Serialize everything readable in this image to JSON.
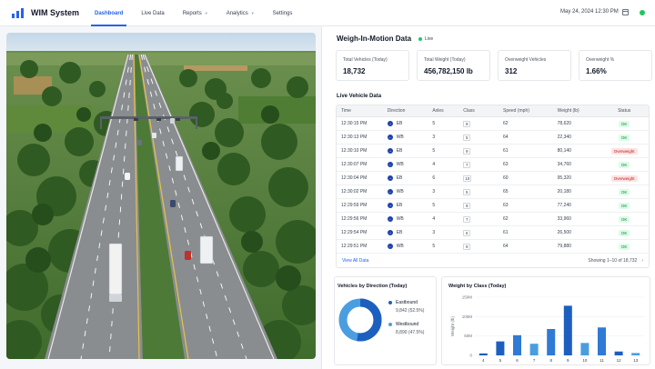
{
  "app": {
    "title": "WIM System"
  },
  "nav": {
    "dashboard": "Dashboard",
    "live_data": "Live Data",
    "reports": "Reports",
    "analytics": "Analytics",
    "settings": "Settings"
  },
  "header": {
    "datetime": "May 24, 2024  12:30 PM"
  },
  "panel": {
    "title": "Weigh-In-Motion Data",
    "live_label": "Live"
  },
  "stats": [
    {
      "label": "Total Vehicles (Today)",
      "value": "18,732"
    },
    {
      "label": "Total Weight (Today)",
      "value": "456,782,150 lb"
    },
    {
      "label": "Overweight Vehicles",
      "value": "312"
    },
    {
      "label": "Overweight %",
      "value": "1.66%"
    }
  ],
  "live_table": {
    "title": "Live Vehicle Data",
    "columns": [
      "Time",
      "Direction",
      "Axles",
      "Class",
      "Speed (mph)",
      "Weight (lb)",
      "Status"
    ],
    "rows": [
      {
        "time": "12:30:15 PM",
        "dir": "EB",
        "axles": "5",
        "class": "9",
        "speed": "62",
        "weight": "78,620",
        "status": "OK"
      },
      {
        "time": "12:30:13 PM",
        "dir": "WB",
        "axles": "3",
        "class": "5",
        "speed": "64",
        "weight": "22,340",
        "status": "OK"
      },
      {
        "time": "12:30:10 PM",
        "dir": "EB",
        "axles": "5",
        "class": "9",
        "speed": "61",
        "weight": "80,140",
        "status": "Overweight"
      },
      {
        "time": "12:30:07 PM",
        "dir": "WB",
        "axles": "4",
        "class": "7",
        "speed": "63",
        "weight": "34,760",
        "status": "OK"
      },
      {
        "time": "12:30:04 PM",
        "dir": "EB",
        "axles": "6",
        "class": "10",
        "speed": "60",
        "weight": "95,320",
        "status": "Overweight"
      },
      {
        "time": "12:30:02 PM",
        "dir": "WB",
        "axles": "3",
        "class": "5",
        "speed": "65",
        "weight": "20,180",
        "status": "OK"
      },
      {
        "time": "12:29:59 PM",
        "dir": "EB",
        "axles": "5",
        "class": "9",
        "speed": "63",
        "weight": "77,240",
        "status": "OK"
      },
      {
        "time": "12:29:56 PM",
        "dir": "WB",
        "axles": "4",
        "class": "7",
        "speed": "62",
        "weight": "33,960",
        "status": "OK"
      },
      {
        "time": "12:29:54 PM",
        "dir": "EB",
        "axles": "3",
        "class": "6",
        "speed": "61",
        "weight": "26,500",
        "status": "OK"
      },
      {
        "time": "12:29:51 PM",
        "dir": "WB",
        "axles": "5",
        "class": "9",
        "speed": "64",
        "weight": "79,880",
        "status": "OK"
      }
    ],
    "view_all": "View All Data",
    "showing": "Showing 1–10 of 18,732"
  },
  "direction_chart": {
    "title": "Vehicles by Direction (Today)",
    "items": [
      {
        "name": "Eastbound",
        "value": "9,842 (52.5%)",
        "pct": 52.5,
        "color": "#1d5fbf"
      },
      {
        "name": "Westbound",
        "value": "8,890 (47.5%)",
        "pct": 47.5,
        "color": "#4a9ee0"
      }
    ]
  },
  "chart_data": {
    "type": "bar",
    "title": "Weight by Class (Today)",
    "ylabel": "Weight (lb)",
    "xlabel": "",
    "categories": [
      "4",
      "5",
      "6",
      "7",
      "8",
      "9",
      "10",
      "11",
      "12",
      "13"
    ],
    "values": [
      5,
      36,
      52,
      30,
      68,
      128,
      32,
      72,
      10,
      6
    ],
    "yticks": [
      "0",
      "50M",
      "100M",
      "150M"
    ],
    "ylim": [
      0,
      150
    ],
    "colors": [
      "#1d5fbf",
      "#1d5fbf",
      "#2f7ad6",
      "#4a9ee0",
      "#2f7ad6",
      "#1d5fbf",
      "#4a9ee0",
      "#2f7ad6",
      "#1d5fbf",
      "#4a9ee0"
    ]
  }
}
